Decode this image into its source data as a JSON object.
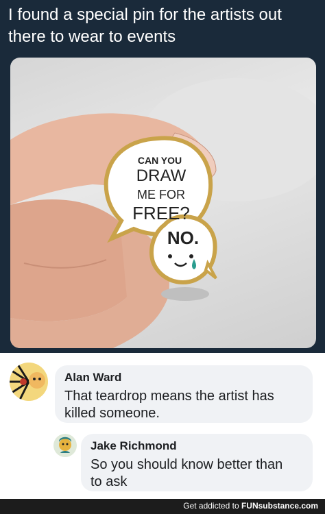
{
  "tweet": {
    "text": "I found a special pin for the artists out there to wear to events"
  },
  "pin": {
    "line1": "CAN YOU",
    "line2": "DRAW",
    "line3": "ME FOR",
    "line4": "FREE?",
    "reply": "NO."
  },
  "comments": [
    {
      "name": "Alan Ward",
      "text_line1": "That teardrop means the artist has",
      "text_line2": "killed someone."
    },
    {
      "name": "Jake Richmond",
      "text_line1": "So you should know better than",
      "text_line2": "to ask"
    }
  ],
  "footer": {
    "prefix": "Get addicted to",
    "brand": "FUNsubstance.com"
  },
  "colors": {
    "tweet_bg": "#1a2a3a",
    "bubble_bg": "#f0f2f5",
    "pin_gold": "#c9a34a"
  }
}
